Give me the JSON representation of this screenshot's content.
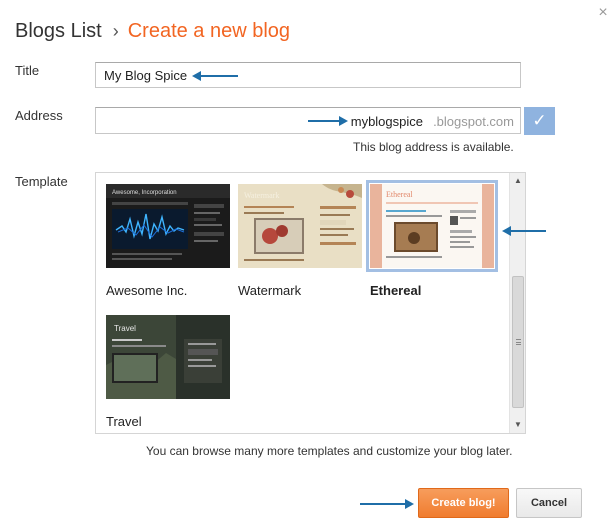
{
  "breadcrumb": {
    "root": "Blogs List",
    "separator": "›",
    "current": "Create a new blog"
  },
  "dialog": {
    "close_glyph": "×"
  },
  "form": {
    "title_label": "Title",
    "title_value": "My Blog Spice",
    "address_label": "Address",
    "address_value": "myblogspice",
    "address_suffix": ".blogspot.com",
    "address_status": "This blog address is available.",
    "address_check_glyph": "✓",
    "template_label": "Template"
  },
  "templates": [
    {
      "name": "Awesome Inc.",
      "thumb_title": "Awesome, Incorporation",
      "selected": false
    },
    {
      "name": "Watermark",
      "thumb_title": "Watermark",
      "selected": false
    },
    {
      "name": "Ethereal",
      "thumb_title": "Ethereal",
      "selected": true
    },
    {
      "name": "Travel",
      "thumb_title": "Travel",
      "selected": false
    }
  ],
  "scrollbar": {
    "up_glyph": "▲",
    "down_glyph": "▼"
  },
  "browse_note": "You can browse many more templates and customize your blog later.",
  "buttons": {
    "create": "Create blog!",
    "cancel": "Cancel"
  },
  "colors": {
    "accent_orange": "#f26522",
    "annotation_arrow": "#1f6ea8",
    "selected_outline": "#a3bfe3"
  }
}
